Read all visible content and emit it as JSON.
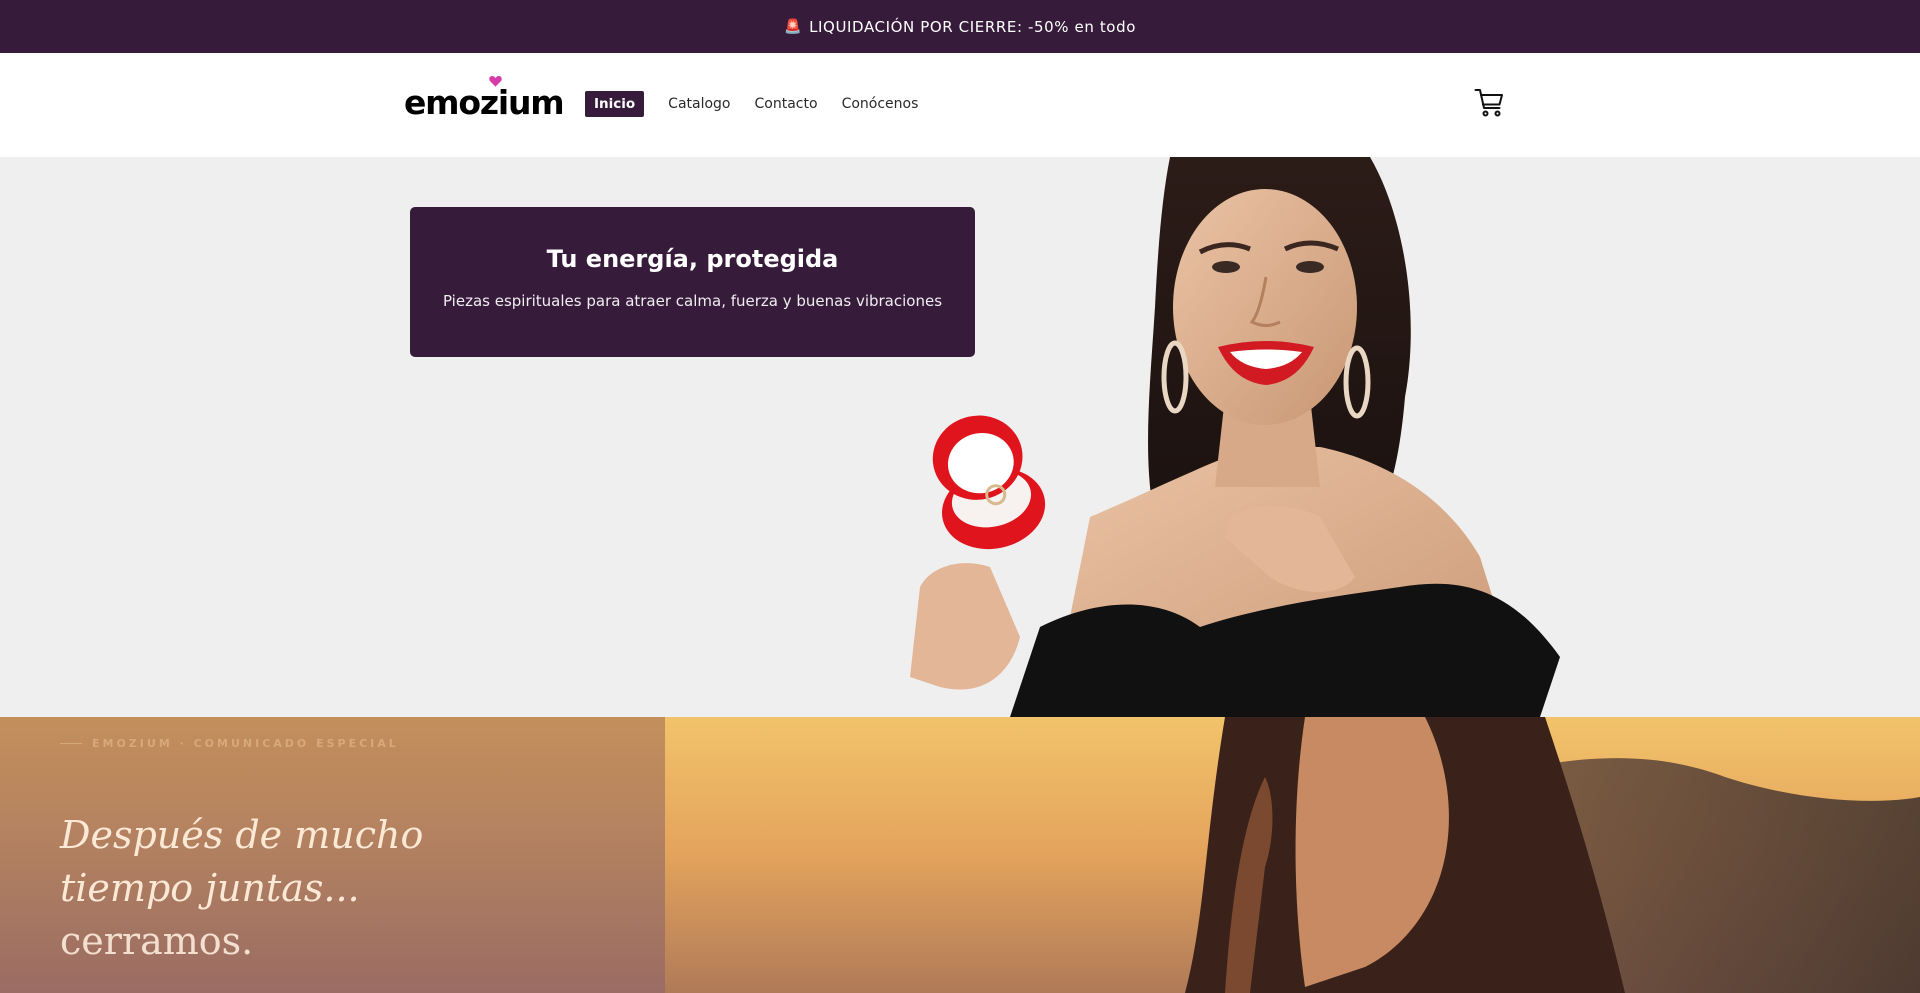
{
  "announcement": {
    "icon": "siren-icon",
    "text": "LIQUIDACIÓN POR CIERRE: -50% en todo"
  },
  "header": {
    "logo_text": "emozium",
    "nav": [
      {
        "label": "Inicio",
        "active": true
      },
      {
        "label": "Catalogo",
        "active": false
      },
      {
        "label": "Contacto",
        "active": false
      },
      {
        "label": "Conócenos",
        "active": false
      }
    ],
    "cart_icon": "cart-icon"
  },
  "hero": {
    "title": "Tu energía, protegida",
    "subtitle": "Piezas espirituales para atraer calma, fuerza y buenas vibraciones"
  },
  "closing": {
    "eyebrow": "EMOZIUM · COMUNICADO ESPECIAL",
    "heading_line1": "Después de mucho",
    "heading_line2": "tiempo juntas...",
    "heading_line3": "cerramos."
  },
  "colors": {
    "brand": "#361c3a",
    "hero_bg": "#efefef",
    "logo_heart": "#d63aa6"
  }
}
